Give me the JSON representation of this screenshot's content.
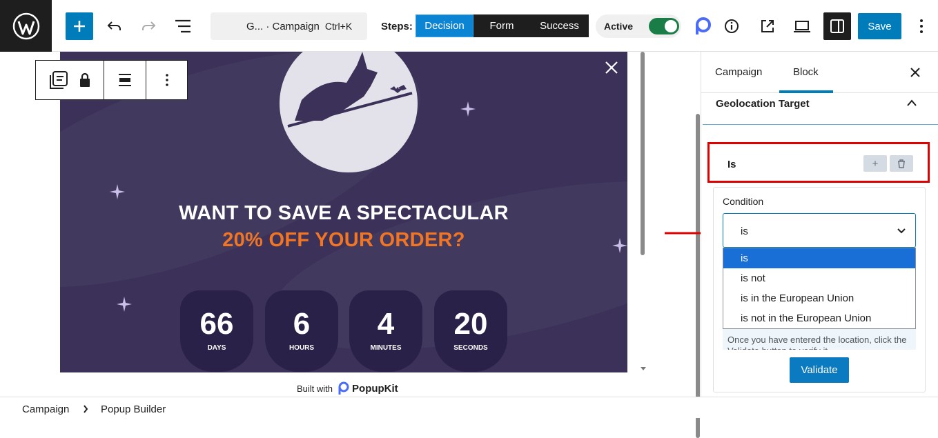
{
  "topbar": {
    "command_title": "G... · Campaign",
    "command_shortcut": "Ctrl+K",
    "steps_label": "Steps:",
    "steps": [
      "Decision",
      "Form",
      "Success"
    ],
    "active_label": "Active",
    "save_label": "Save"
  },
  "popup": {
    "headline_1": "WANT TO SAVE A SPECTACULAR",
    "headline_2": "20% OFF YOUR ORDER?",
    "countdown": [
      {
        "value": "66",
        "unit": "DAYS"
      },
      {
        "value": "6",
        "unit": "HOURS"
      },
      {
        "value": "4",
        "unit": "MINUTES"
      },
      {
        "value": "20",
        "unit": "SECONDS"
      }
    ],
    "built_with": "Built with",
    "brand": "PopupKit"
  },
  "sidebar": {
    "tabs": [
      "Campaign",
      "Block"
    ],
    "panel_title": "Geolocation Target",
    "rule_label": "Is",
    "condition_label": "Condition",
    "selected_value": "is",
    "options": [
      "is",
      "is not",
      "is in the European Union",
      "is not in the European Union"
    ],
    "help_text": "Once you have entered the location, click the Validate button to verify it.",
    "validate_label": "Validate"
  },
  "breadcrumb": [
    "Campaign",
    "Popup Builder"
  ],
  "colors": {
    "accent": "#007cba",
    "popup_bg": "#3c3259",
    "headline_orange": "#f27524",
    "highlight_red": "#e10000"
  }
}
